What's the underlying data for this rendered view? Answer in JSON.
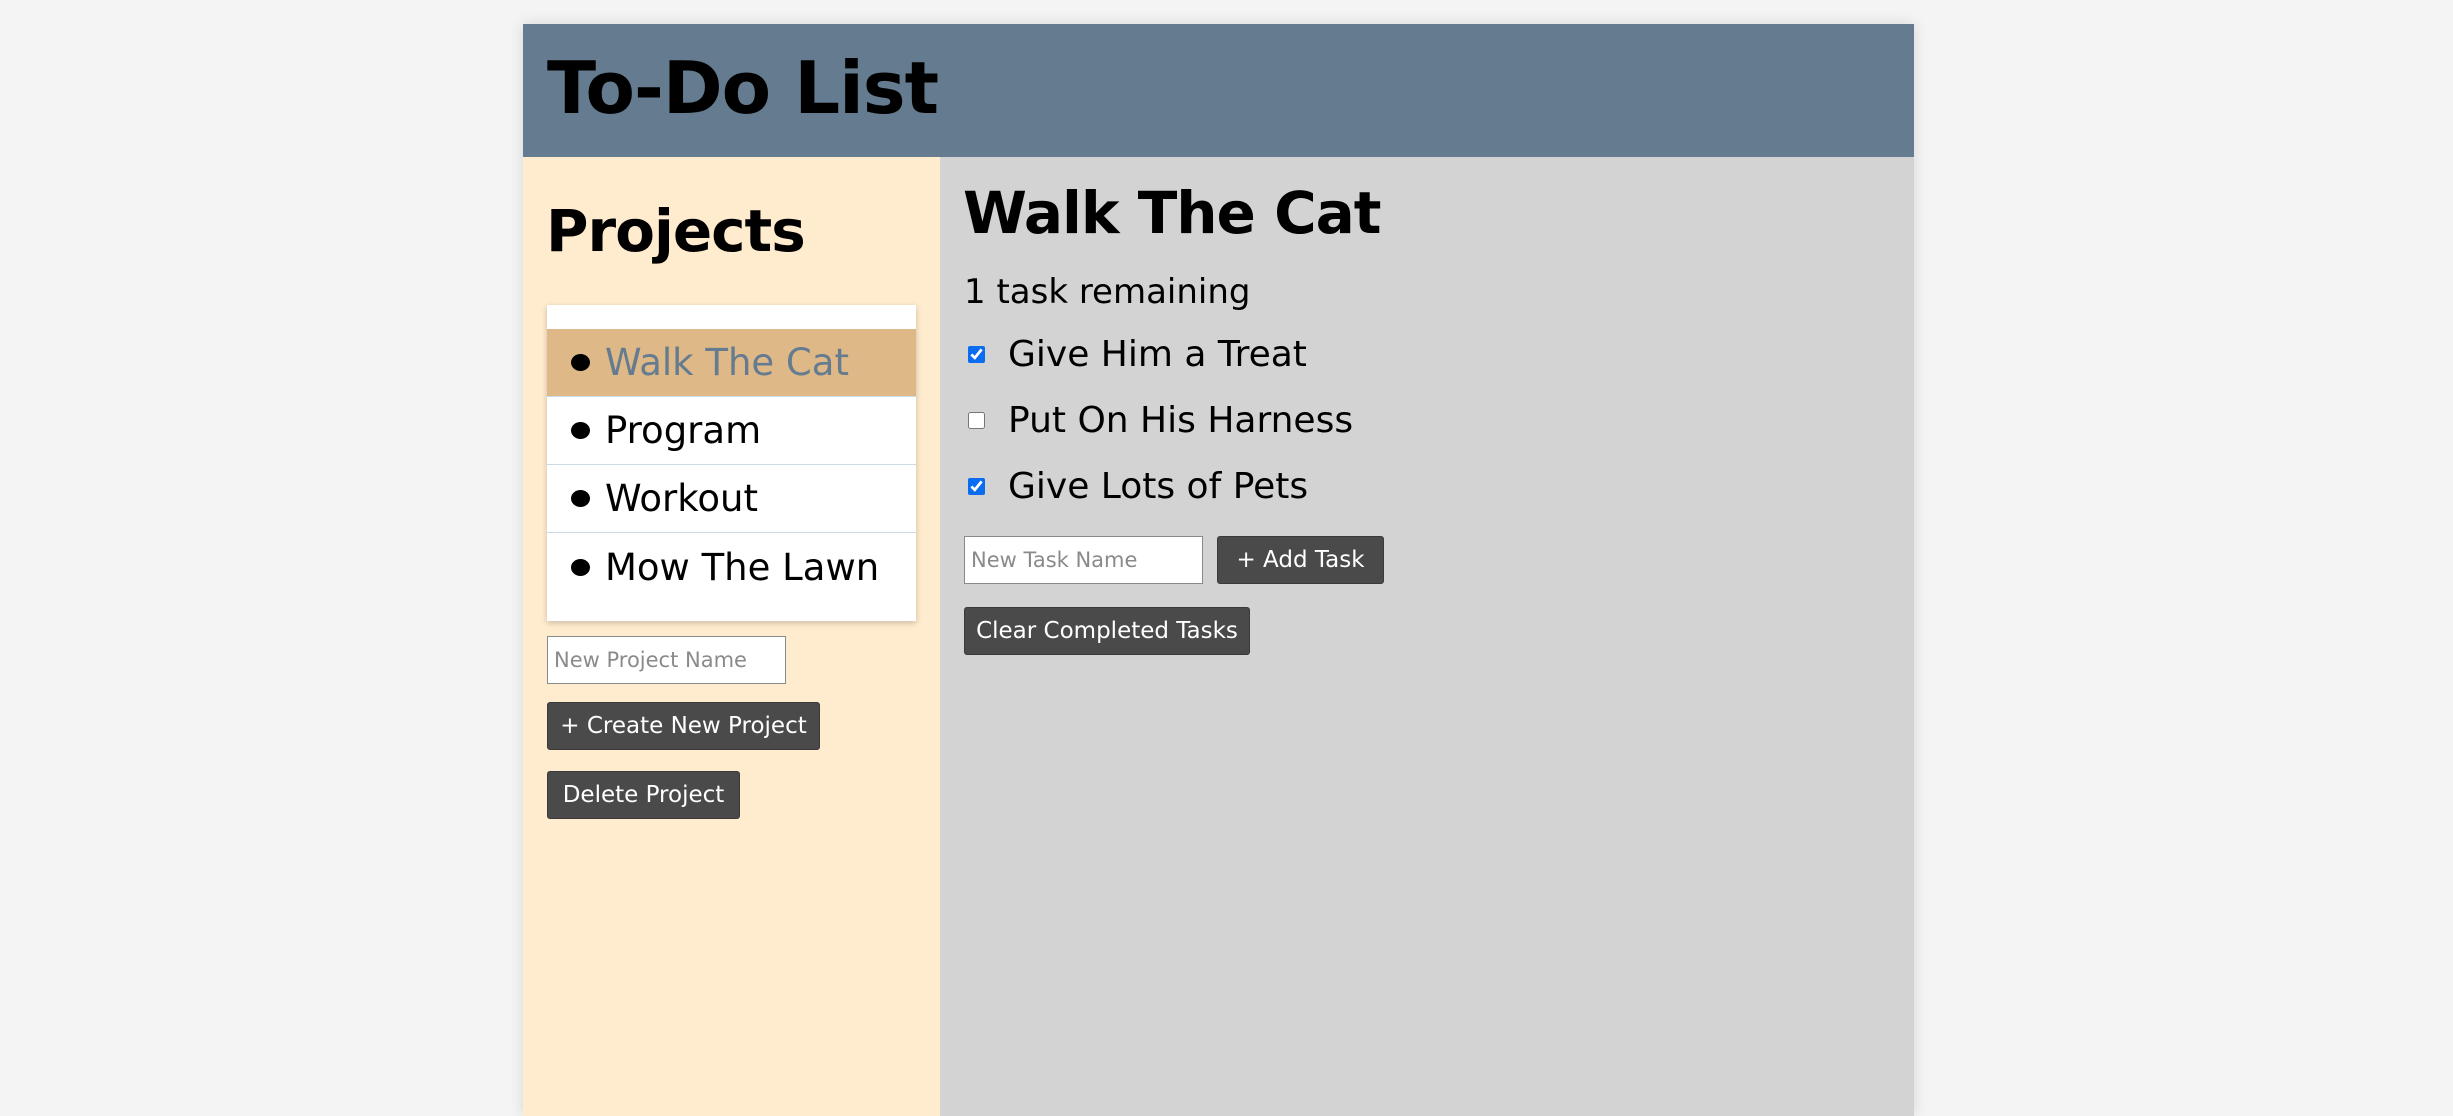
{
  "header": {
    "title": "To-Do List"
  },
  "sidebar": {
    "heading": "Projects",
    "projects": [
      {
        "label": "Walk The Cat",
        "active": true
      },
      {
        "label": "Program",
        "active": false
      },
      {
        "label": "Workout",
        "active": false
      },
      {
        "label": "Mow The Lawn",
        "active": false
      }
    ],
    "new_project_placeholder": "New Project Name",
    "create_label": "+ Create New Project",
    "delete_label": "Delete Project"
  },
  "main": {
    "project_title": "Walk The Cat",
    "remaining_text": "1 task remaining",
    "tasks": [
      {
        "label": "Give Him a Treat",
        "completed": true
      },
      {
        "label": "Put On His Harness",
        "completed": false
      },
      {
        "label": "Give Lots of Pets",
        "completed": true
      }
    ],
    "new_task_placeholder": "New Task Name",
    "add_task_label": "+ Add Task",
    "clear_label": "Clear Completed Tasks"
  },
  "colors": {
    "header": "#647b90",
    "sidebar": "#ffebcd",
    "active_project": "#deb887",
    "main": "#d3d3d3",
    "button": "#4a4a4a"
  }
}
